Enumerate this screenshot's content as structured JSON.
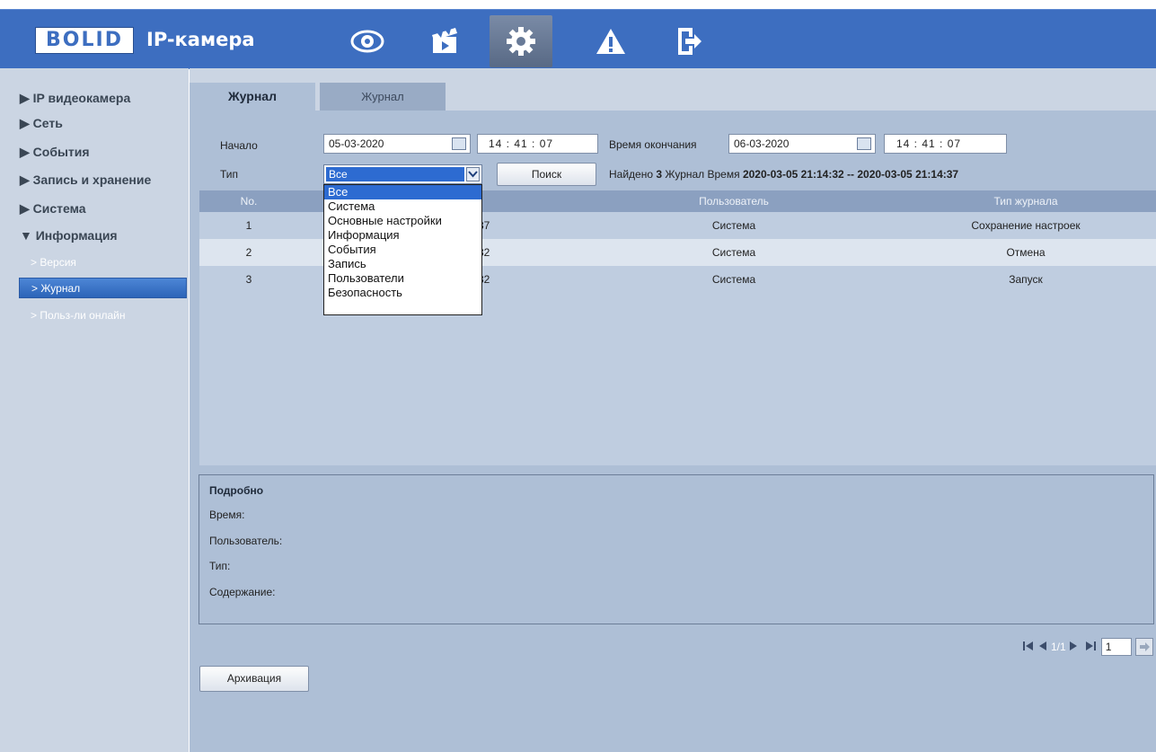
{
  "header": {
    "logo_text": "BOLID",
    "app_title": "IP-камера",
    "nav": [
      {
        "name": "live-view-icon"
      },
      {
        "name": "playback-icon"
      },
      {
        "name": "settings-icon"
      },
      {
        "name": "alarm-icon"
      },
      {
        "name": "logout-icon"
      }
    ]
  },
  "sidebar": {
    "items": [
      {
        "label": "▶ IP видеокамера"
      },
      {
        "label": "▶ Сеть"
      },
      {
        "label": "▶ События"
      },
      {
        "label": "▶ Запись и хранение"
      },
      {
        "label": "▶ Система"
      },
      {
        "label": "▼ Информация"
      }
    ],
    "sub_items": [
      {
        "label": "> Версия"
      },
      {
        "label": "> Журнал"
      },
      {
        "label": "> Польз-ли онлайн"
      }
    ]
  },
  "tabs": [
    {
      "label": "Журнал"
    },
    {
      "label": "Журнал"
    }
  ],
  "search": {
    "start_label": "Начало",
    "start_date": "05-03-2020",
    "start_time": "14 :  41 :  07",
    "end_label": "Время окончания",
    "end_date": "06-03-2020",
    "end_time": "14 :  41 :  07",
    "type_label": "Тип",
    "type_value": "Все",
    "search_button": "Поиск",
    "found_prefix": "Найдено ",
    "found_count": "3",
    "found_mid": " Журнал Время ",
    "found_range": "2020-03-05 21:14:32 -- 2020-03-05 21:14:37"
  },
  "dropdown_options": [
    "Все",
    "Система",
    "Основные настройки",
    "Информация",
    "События",
    "Запись",
    "Пользователи",
    "Безопасность"
  ],
  "table": {
    "headers": [
      "No.",
      "Пользователь",
      "Тип журнала"
    ],
    "rows": [
      {
        "no": "1",
        "time_tail": "37",
        "user": "Система",
        "type": "Сохранение настроек"
      },
      {
        "no": "2",
        "time_tail": "32",
        "user": "Система",
        "type": "Отмена"
      },
      {
        "no": "3",
        "time_tail": "32",
        "user": "Система",
        "type": "Запуск"
      }
    ]
  },
  "details": {
    "title": "Подробно",
    "time_label": "Время:",
    "user_label": "Пользователь:",
    "type_label": "Тип:",
    "content_label": "Содержание:"
  },
  "pager": {
    "page_text": "1/1",
    "page_input": "1"
  },
  "archive_button": "Архивация",
  "colors": {
    "header": "#3d6ec0",
    "sidebar": "#cbd5e3",
    "main": "#aebfd6",
    "selection": "#2d6bd1"
  }
}
